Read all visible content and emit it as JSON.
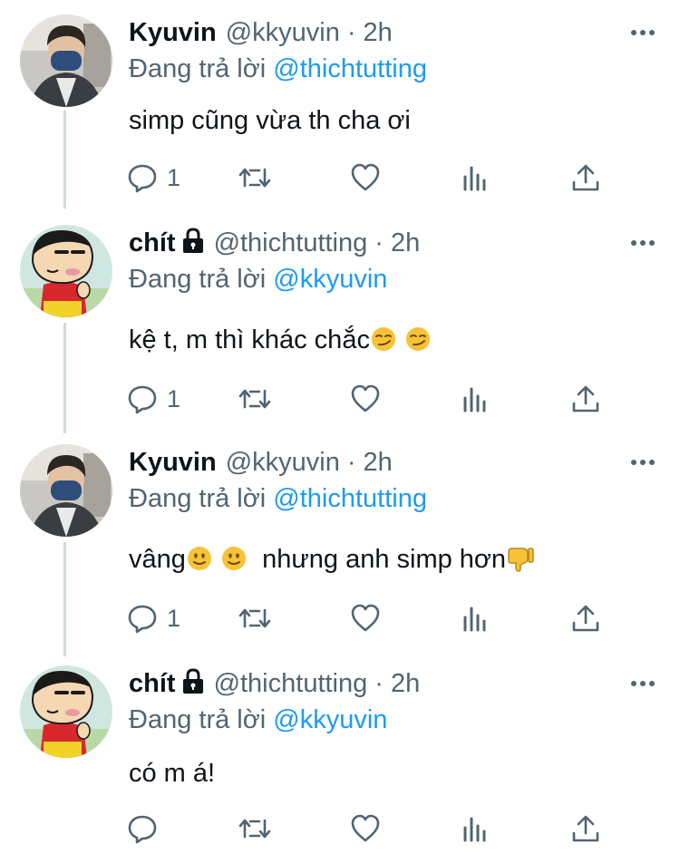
{
  "tweets": [
    {
      "name": "Kyuvin",
      "handle": "@kkyuvin",
      "separator": "·",
      "time": "2h",
      "replying_prefix": "Đang trả lời",
      "replying_to": "@thichtutting",
      "text": "simp cũng vừa th cha ơi",
      "reply_count": "1",
      "protected": false
    },
    {
      "name": "chít",
      "handle": "@thichtutting",
      "separator": "·",
      "time": "2h",
      "replying_prefix": "Đang trả lời",
      "replying_to": "@kkyuvin",
      "text": "kệ t, m thì khác chắc",
      "reply_count": "1",
      "protected": true
    },
    {
      "name": "Kyuvin",
      "handle": "@kkyuvin",
      "separator": "·",
      "time": "2h",
      "replying_prefix": "Đang trả lời",
      "replying_to": "@thichtutting",
      "text_a": "vâng",
      "text_b": "nhưng anh simp hơn",
      "reply_count": "1",
      "protected": false
    },
    {
      "name": "chít",
      "handle": "@thichtutting",
      "separator": "·",
      "time": "2h",
      "replying_prefix": "Đang trả lời",
      "replying_to": "@kkyuvin",
      "text": "có m á!",
      "reply_count": "",
      "protected": true
    }
  ],
  "icons": {
    "reply": "speech-bubble-icon",
    "retweet": "retweet-icon",
    "like": "heart-icon",
    "views": "bar-chart-icon",
    "share": "share-upload-icon",
    "more": "more-dots-icon",
    "lock": "lock-icon"
  },
  "colors": {
    "mention": "#1d9bf0",
    "secondary_text": "#536471",
    "thread_line": "#cfd9de"
  }
}
